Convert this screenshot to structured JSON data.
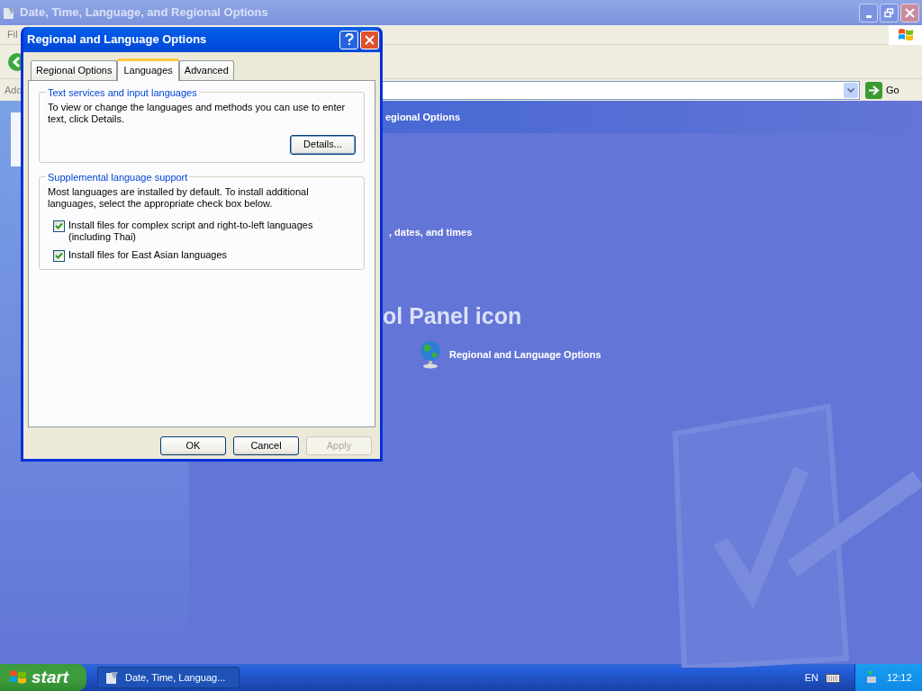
{
  "window": {
    "title": "Date, Time, Language, and Regional Options",
    "menu": [
      "Fil"
    ],
    "address_label": "Add",
    "go_button": "Go"
  },
  "content": {
    "header": "egional Options",
    "task_text": ", dates, and times",
    "section_title": "ol Panel icon",
    "icon_link": "Regional and Language Options"
  },
  "dialog": {
    "title": "Regional and Language Options",
    "tabs": [
      {
        "label": "Regional Options",
        "selected": false
      },
      {
        "label": "Languages",
        "selected": true
      },
      {
        "label": "Advanced",
        "selected": false
      }
    ],
    "groups": [
      {
        "title": "Text services and input languages",
        "text": "To view or change the languages and methods you can use to enter text, click Details.",
        "button": "Details..."
      },
      {
        "title": "Supplemental language support",
        "text": "Most languages are installed by default. To install additional languages, select the appropriate check box below.",
        "checkboxes": [
          {
            "label": "Install files for complex script and right-to-left languages (including Thai)",
            "checked": true
          },
          {
            "label": "Install files for East Asian languages",
            "checked": true
          }
        ]
      }
    ],
    "buttons": [
      {
        "label": "OK",
        "disabled": false
      },
      {
        "label": "Cancel",
        "disabled": false
      },
      {
        "label": "Apply",
        "disabled": true
      }
    ]
  },
  "taskbar": {
    "start": "start",
    "tasks": [
      {
        "label": "Date, Time, Languag...",
        "selected": true
      }
    ],
    "language": "EN",
    "clock": "12:12"
  }
}
